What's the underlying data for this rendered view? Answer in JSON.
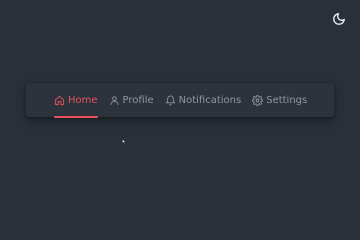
{
  "theme_toggle": {
    "icon": "moon-icon"
  },
  "nav": {
    "items": [
      {
        "label": "Home",
        "icon": "home-icon",
        "active": true
      },
      {
        "label": "Profile",
        "icon": "user-icon",
        "active": false
      },
      {
        "label": "Notifications",
        "icon": "bell-icon",
        "active": false
      },
      {
        "label": "Settings",
        "icon": "gear-icon",
        "active": false
      }
    ]
  },
  "colors": {
    "background": "#2a3039",
    "navbar": "#2c333c",
    "accent": "#e8505b",
    "muted_text": "#8e96a2",
    "icon_light": "#e6e8eb"
  }
}
